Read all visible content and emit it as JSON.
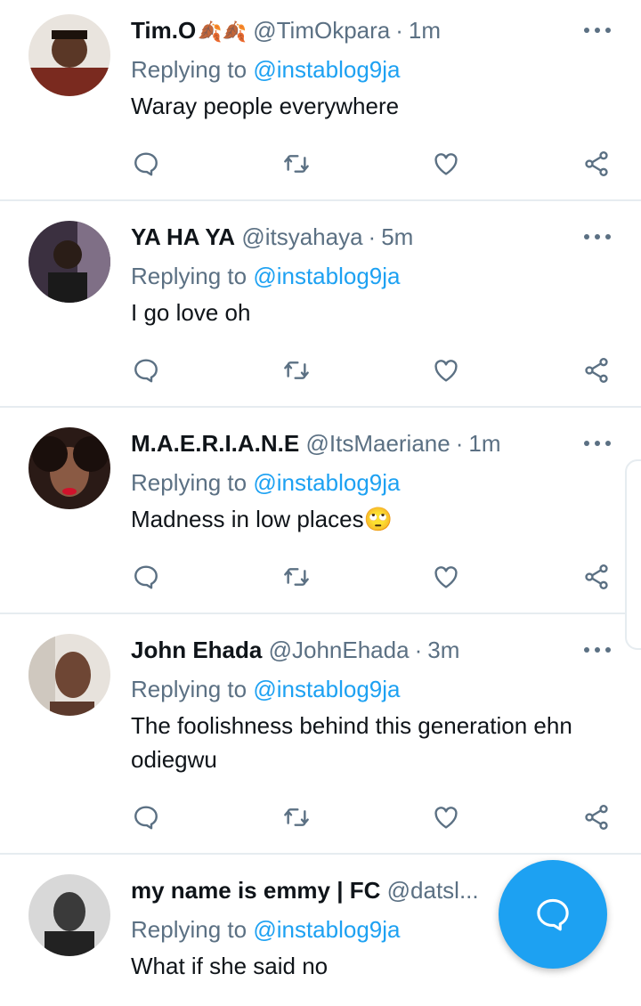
{
  "tweets": [
    {
      "name": "Tim.O",
      "name_emoji": "🍂🍂",
      "handle": "@TimOkpara",
      "time": "1m",
      "replying_prefix": "Replying to",
      "replying_to": "@instablog9ja",
      "text": "Waray people everywhere",
      "emoji": ""
    },
    {
      "name": "YA HA YA",
      "name_emoji": "",
      "handle": "@itsyahaya",
      "time": "5m",
      "replying_prefix": "Replying to",
      "replying_to": "@instablog9ja",
      "text": "I go love oh",
      "emoji": ""
    },
    {
      "name": "M.A.E.R.I.A.N.E",
      "name_emoji": "",
      "handle": "@ItsMaeriane",
      "time": "1m",
      "replying_prefix": "Replying to",
      "replying_to": "@instablog9ja",
      "text": "Madness in low places",
      "emoji": "🙄"
    },
    {
      "name": "John Ehada",
      "name_emoji": "",
      "handle": "@JohnEhada",
      "time": "3m",
      "replying_prefix": "Replying to",
      "replying_to": "@instablog9ja",
      "text": "The foolishness behind this generation ehn odiegwu",
      "emoji": ""
    },
    {
      "name": "my name is emmy | FC",
      "name_emoji": "",
      "handle": "@datsl...",
      "time": "",
      "replying_prefix": "Replying to",
      "replying_to": "@instablog9ja",
      "text": "What if she said no",
      "emoji": ""
    }
  ],
  "icons": {
    "reply": "comment-icon",
    "retweet": "retweet-icon",
    "like": "heart-icon",
    "share": "share-icon",
    "more": "more-icon",
    "compose": "compose-reply-icon"
  },
  "colors": {
    "accent": "#1da1f2",
    "secondary_text": "#5b7083",
    "divider": "#e6ecf0"
  }
}
